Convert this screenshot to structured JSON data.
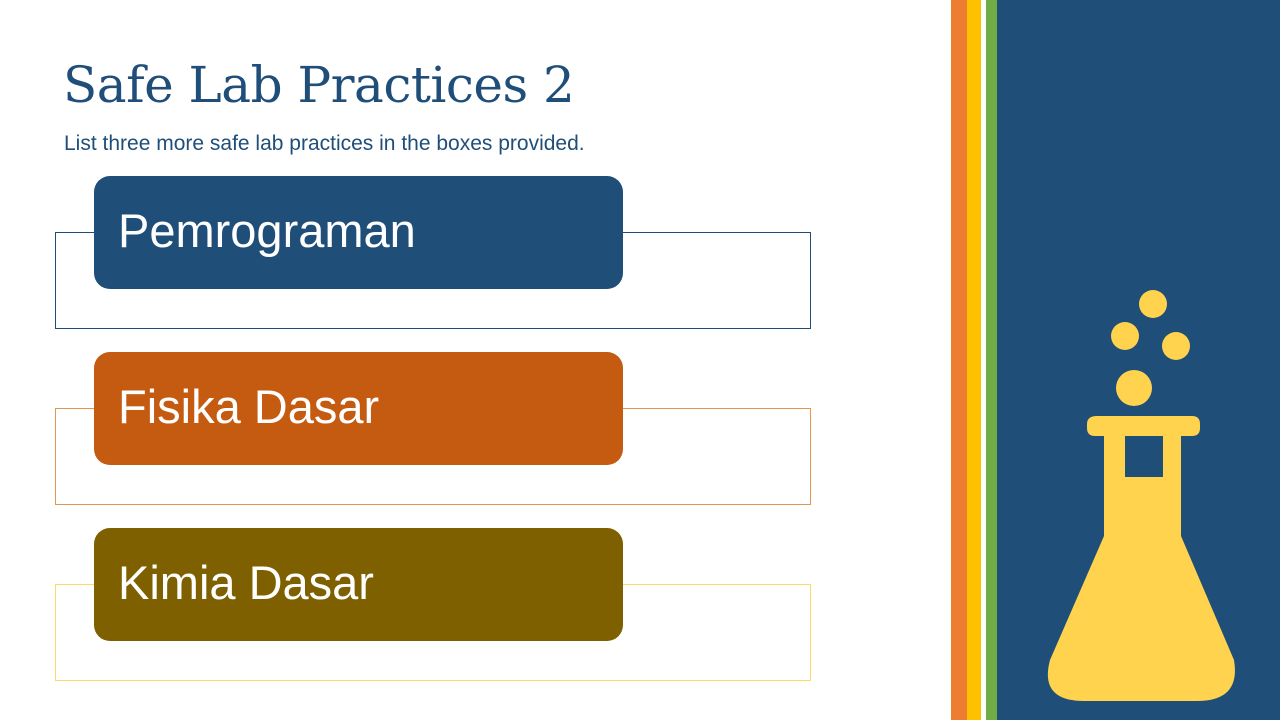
{
  "slide": {
    "title": "Safe Lab Practices 2",
    "subtitle": "List three more safe lab practices in the boxes provided.",
    "items": [
      {
        "label": "Pemrograman",
        "color": "#1F4E79",
        "outline": "#1F4E79"
      },
      {
        "label": "Fisika Dasar",
        "color": "#C55A11",
        "outline": "#E3964D"
      },
      {
        "label": "Kimia Dasar",
        "color": "#7F6000",
        "outline": "#FFD966"
      }
    ]
  },
  "colors": {
    "title": "#1F4E79",
    "panel": "#1F4E79",
    "stripe_orange": "#ED7D31",
    "stripe_yellow": "#FFC000",
    "stripe_green": "#70AD47",
    "flask": "#FFD34E"
  },
  "icons": {
    "decor": "flask-icon"
  }
}
